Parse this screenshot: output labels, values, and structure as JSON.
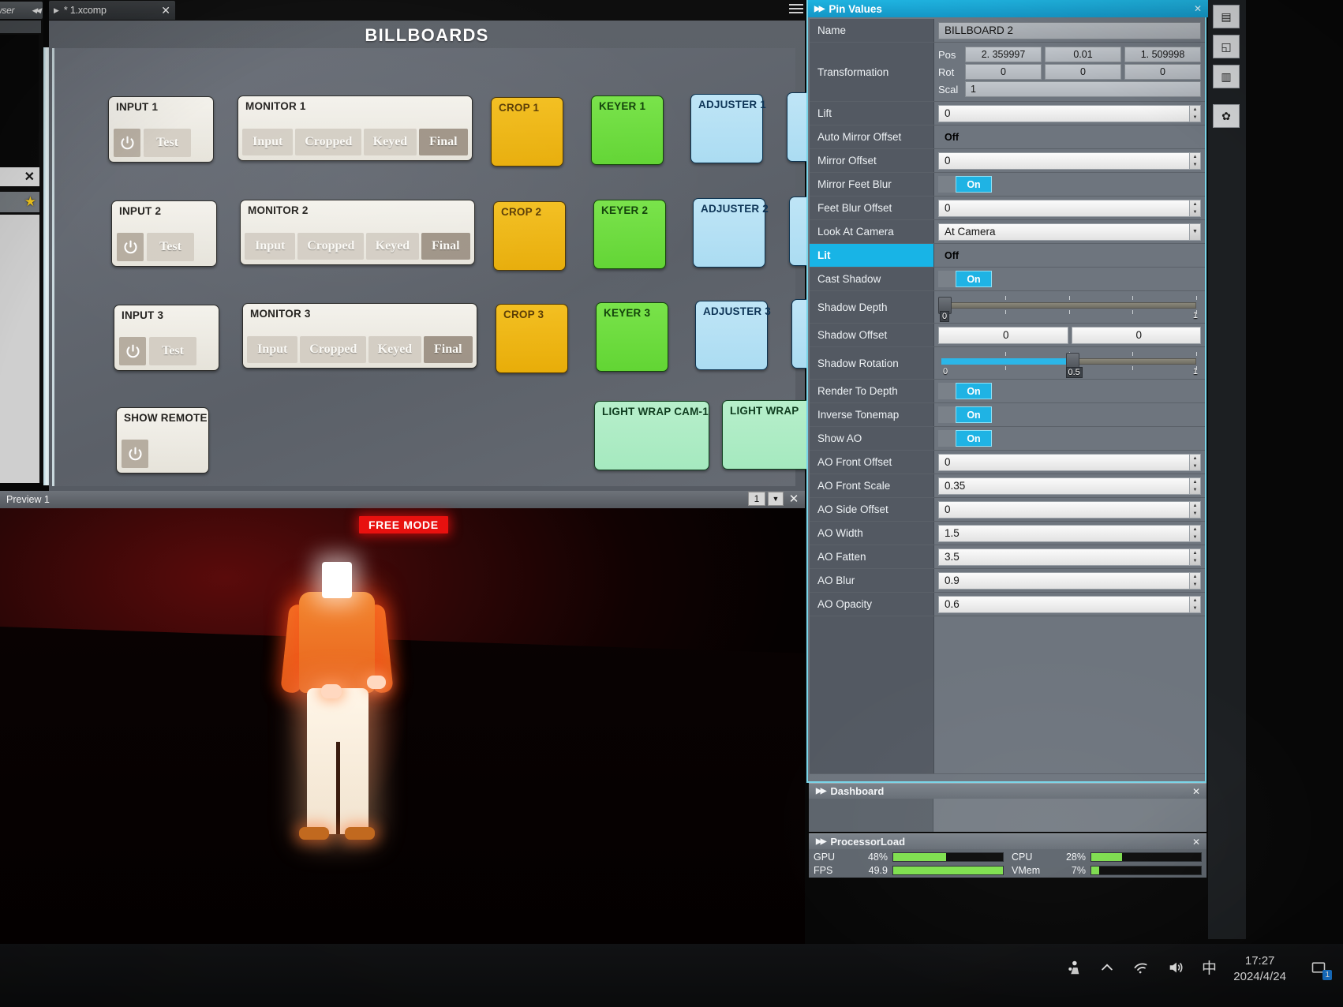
{
  "left_strip": {
    "header_label": "wser",
    "collapse_icon": "double-left-arrow",
    "close_icon": "close-icon",
    "star_icon": "star-icon"
  },
  "comp_window": {
    "tab": {
      "label": "* 1.xcomp",
      "play_icon": "play-triangle-icon",
      "close_icon": "close-icon"
    },
    "menu_icon": "hamburger-icon",
    "title": "BILLBOARDS"
  },
  "billboards": {
    "inputs": [
      {
        "title": "INPUT 1",
        "power_icon": "power-icon",
        "test_label": "Test"
      },
      {
        "title": "INPUT 2",
        "power_icon": "power-icon",
        "test_label": "Test"
      },
      {
        "title": "INPUT 3",
        "power_icon": "power-icon",
        "test_label": "Test"
      }
    ],
    "monitors": [
      {
        "title": "MONITOR 1",
        "buttons": [
          "Input",
          "Cropped",
          "Keyed",
          "Final"
        ],
        "selected": "Final"
      },
      {
        "title": "MONITOR 2",
        "buttons": [
          "Input",
          "Cropped",
          "Keyed",
          "Final"
        ],
        "selected": "Final"
      },
      {
        "title": "MONITOR 3",
        "buttons": [
          "Input",
          "Cropped",
          "Keyed",
          "Final"
        ],
        "selected": "Final"
      }
    ],
    "crops": [
      "CROP 1",
      "CROP 2",
      "CROP 3"
    ],
    "keyers": [
      "KEYER 1",
      "KEYER 2",
      "KEYER 3"
    ],
    "adjusters": [
      "ADJUSTER 1",
      "ADJUSTER 2",
      "ADJUSTER 3"
    ],
    "light_wraps": [
      "LIGHT WRAP CAM-1",
      "LIGHT WRAP"
    ],
    "show_remote": {
      "title": "SHOW REMOTE",
      "power_icon": "power-icon"
    },
    "colors": {
      "crop": "#eeb614",
      "keyer": "#6cd93c",
      "adjuster": "#b3dff3",
      "light_wrap": "#aeecc4",
      "panel": "#eeebe3"
    }
  },
  "preview": {
    "title": "Preview 1",
    "page_number": "1",
    "dropdown_icon": "chevron-down-icon",
    "close_icon": "close-icon",
    "mode_badge": "FREE MODE",
    "mode_badge_color": "#e8110f"
  },
  "pin_values": {
    "panel_title": "Pin Values",
    "expand_icon": "double-right-arrow-icon",
    "close_icon": "close-icon",
    "accent_color": "#1fb3e0",
    "rows": [
      {
        "label": "Name",
        "type": "text-grey",
        "value": "BILLBOARD 2"
      },
      {
        "label": "Transformation",
        "type": "transform",
        "pos": [
          "2. 359997",
          "0.01",
          "1. 509998"
        ],
        "rot": [
          "0",
          "0",
          "0"
        ],
        "scal": "1",
        "pos_tag": "Pos",
        "rot_tag": "Rot",
        "scal_tag": "Scal"
      },
      {
        "label": "Lift",
        "type": "spinner",
        "value": "0"
      },
      {
        "label": "Auto Mirror Offset",
        "type": "toggle",
        "value": "Off"
      },
      {
        "label": "Mirror Offset",
        "type": "spinner",
        "value": "0"
      },
      {
        "label": "Mirror Feet Blur",
        "type": "toggle",
        "value": "On"
      },
      {
        "label": "Feet Blur Offset",
        "type": "spinner",
        "value": "0"
      },
      {
        "label": "Look At Camera",
        "type": "dropdown",
        "value": "At Camera"
      },
      {
        "label": "Lit",
        "type": "toggle",
        "value": "Off",
        "selected": true
      },
      {
        "label": "Cast Shadow",
        "type": "toggle",
        "value": "On"
      },
      {
        "label": "Shadow Depth",
        "type": "slider",
        "value": "0",
        "min": "0",
        "max": "1",
        "fraction": 0.0
      },
      {
        "label": "Shadow Offset",
        "type": "dual",
        "value_a": "0",
        "value_b": "0"
      },
      {
        "label": "Shadow Rotation",
        "type": "slider",
        "value": "0.5",
        "min": "0",
        "max": "1",
        "fraction": 0.5
      },
      {
        "label": "Render To Depth",
        "type": "toggle",
        "value": "On"
      },
      {
        "label": "Inverse Tonemap",
        "type": "toggle",
        "value": "On"
      },
      {
        "label": "Show AO",
        "type": "toggle",
        "value": "On"
      },
      {
        "label": "AO Front Offset",
        "type": "spinner",
        "value": "0"
      },
      {
        "label": "AO Front Scale",
        "type": "spinner",
        "value": "0.35"
      },
      {
        "label": "AO Side Offset",
        "type": "spinner",
        "value": "0"
      },
      {
        "label": "AO Width",
        "type": "spinner",
        "value": "1.5"
      },
      {
        "label": "AO Fatten",
        "type": "spinner",
        "value": "3.5"
      },
      {
        "label": "AO Blur",
        "type": "spinner",
        "value": "0.9"
      },
      {
        "label": "AO Opacity",
        "type": "spinner",
        "value": "0.6"
      }
    ]
  },
  "dashboard": {
    "title": "Dashboard",
    "expand_icon": "double-right-arrow-icon",
    "close_icon": "close-icon"
  },
  "processor_load": {
    "title": "ProcessorLoad",
    "expand_icon": "double-right-arrow-icon",
    "close_icon": "close-icon",
    "bar_color": "#7fe04f",
    "meters": [
      {
        "name": "GPU",
        "value": "48%",
        "fraction": 0.48
      },
      {
        "name": "CPU",
        "value": "28%",
        "fraction": 0.28
      },
      {
        "name": "FPS",
        "value": "49.9",
        "fraction": 1.0
      },
      {
        "name": "VMem",
        "value": "7%",
        "fraction": 0.07
      }
    ]
  },
  "taskbar": {
    "icons": [
      "people-share-icon",
      "chevron-up-icon",
      "wifi-icon",
      "volume-icon"
    ],
    "ime_label": "中",
    "time": "17:27",
    "date": "2024/4/24",
    "notification_icon": "notification-icon",
    "notification_count": "1"
  }
}
